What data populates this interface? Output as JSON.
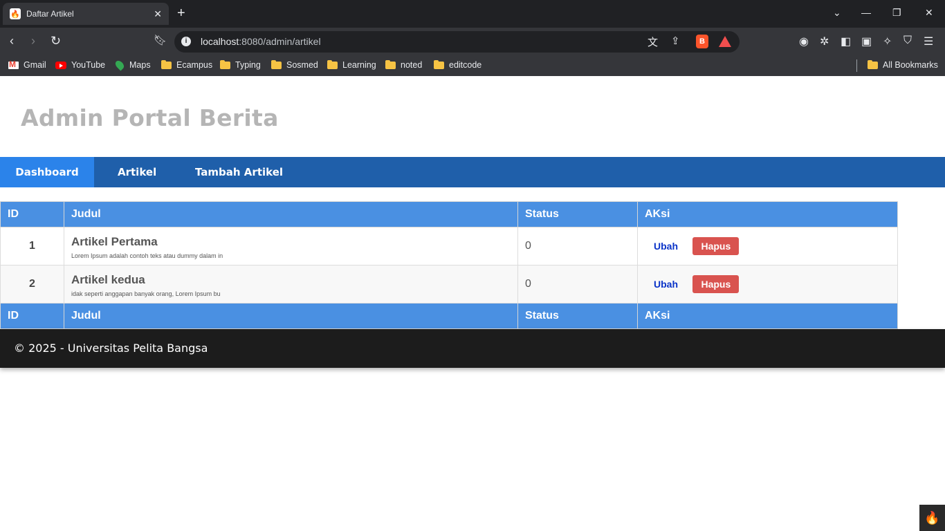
{
  "browser": {
    "tab_title": "Daftar Artikel",
    "tab_close": "✕",
    "new_tab": "+",
    "url_host": "localhost",
    "url_rest": ":8080/admin/artikel",
    "bookmarks": [
      "Gmail",
      "YouTube",
      "Maps",
      "Ecampus",
      "Typing",
      "Sosmed",
      "Learning",
      "noted",
      "editcode"
    ],
    "all_bookmarks": "All Bookmarks"
  },
  "site": {
    "title": "Admin Portal Berita",
    "nav": [
      "Dashboard",
      "Artikel",
      "Tambah Artikel"
    ]
  },
  "table": {
    "headers": [
      "ID",
      "Judul",
      "Status",
      "AKsi"
    ],
    "rows": [
      {
        "id": "1",
        "judul": "Artikel Pertama",
        "ringkas": "Lorem Ipsum adalah contoh teks atau dummy dalam in",
        "status": "0",
        "ubah": "Ubah",
        "hapus": "Hapus"
      },
      {
        "id": "2",
        "judul": "Artikel kedua",
        "ringkas": "idak seperti anggapan banyak orang, Lorem Ipsum bu",
        "status": "0",
        "ubah": "Ubah",
        "hapus": "Hapus"
      }
    ]
  },
  "footer": {
    "text": "© 2025 - Universitas Pelita Bangsa"
  },
  "colors": {
    "nav_bg": "#1f5faa",
    "nav_active": "#2b83ea",
    "table_header": "#4a90e2",
    "delete_button": "#d9534f",
    "footer_bg": "#1c1c1c"
  }
}
